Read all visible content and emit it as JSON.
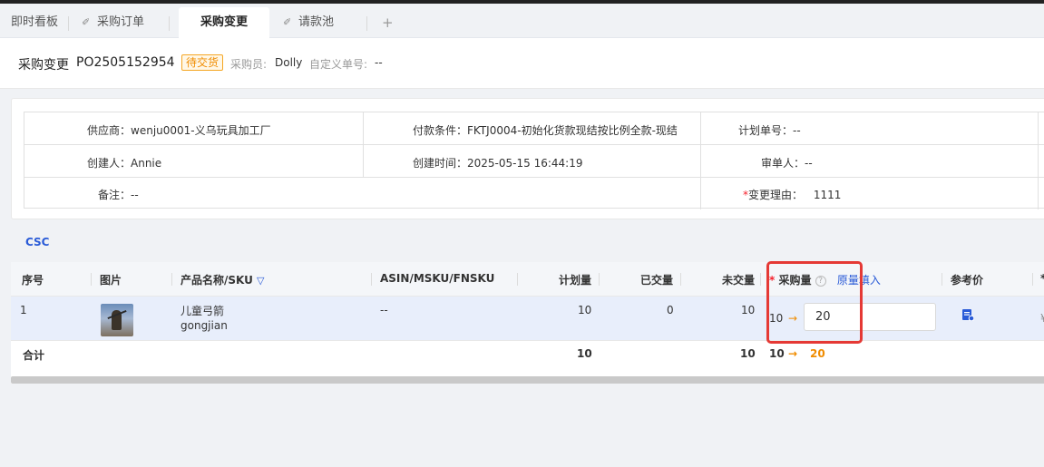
{
  "tabs": [
    {
      "label": "即时看板",
      "pinned": false,
      "active": false
    },
    {
      "label": "采购订单",
      "pinned": true,
      "active": false
    },
    {
      "label": "采购变更",
      "pinned": false,
      "active": true
    },
    {
      "label": "请款池",
      "pinned": true,
      "active": false
    }
  ],
  "tab_add": "+",
  "header": {
    "title": "采购变更",
    "po_number": "PO2505152954",
    "status_badge": "待交货",
    "buyer_label": "采购员:",
    "buyer_value": "Dolly",
    "custom_no_label": "自定义单号:",
    "custom_no_value": "--"
  },
  "info": {
    "supplier": {
      "label": "供应商：",
      "value": "wenju0001-义乌玩具加工厂"
    },
    "payment_terms": {
      "label": "付款条件：",
      "value": "FKTJ0004-初始化货款现结按比例全款-现结"
    },
    "plan_no": {
      "label": "计划单号：",
      "value": "--"
    },
    "creator": {
      "label": "创建人：",
      "value": "Annie"
    },
    "created_time": {
      "label": "创建时间：",
      "value": "2025-05-15 16:44:19"
    },
    "reviewer": {
      "label": "审单人：",
      "value": "--"
    },
    "remark": {
      "label": "备注：",
      "value": "--"
    },
    "change_reason": {
      "required_mark": "*",
      "label": "变更理由：",
      "value": "1111"
    }
  },
  "section_title": "CSC",
  "table": {
    "columns": {
      "index": "序号",
      "image": "图片",
      "product": "产品名称/SKU",
      "asin": "ASIN/MSKU/FNSKU",
      "planned": "计划量",
      "delivered": "已交量",
      "undelivered": "未交量",
      "purchase_qty_required": "*",
      "purchase_qty": "采购量",
      "purchase_qty_help": "?",
      "fill_original": "原量填入",
      "ref_price": "参考价",
      "more_required": "*"
    },
    "rows": [
      {
        "index": "1",
        "product_name": "儿童弓箭",
        "sku": "gongjian",
        "asin": "--",
        "planned": "10",
        "delivered": "0",
        "undelivered": "10",
        "qty_from": "10",
        "qty_arrow": "→",
        "qty_input": "20",
        "ref_price_icon": "document-icon",
        "more_cut": "¥"
      }
    ],
    "total": {
      "label": "合计",
      "planned": "10",
      "undelivered": "10",
      "qty_from": "10",
      "qty_arrow": "→",
      "qty_to": "20"
    }
  },
  "colors": {
    "accent": "#2a5bd7",
    "badge": "#f08c00",
    "highlight_box": "#e53935",
    "selected_row": "#e8eefb"
  }
}
